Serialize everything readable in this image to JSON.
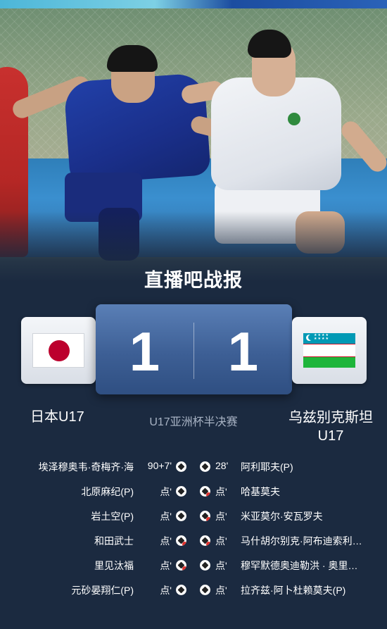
{
  "brand_title": "直播吧战报",
  "match": {
    "stage": "U17亚洲杯半决赛",
    "home": {
      "name": "日本U17",
      "score": "1",
      "flag": "japan-flag"
    },
    "away": {
      "name": "乌兹别克斯坦U17",
      "name_line1": "乌兹别克斯坦",
      "name_line2": "U17",
      "score": "1",
      "flag": "uzbekistan-flag"
    }
  },
  "events": [
    {
      "home_player": "埃泽穆奥韦·奇梅齐·海",
      "home_time": "90+7'",
      "home_result": "goal",
      "away_result": "goal",
      "away_time": "28'",
      "away_player": "阿利耶夫(P)"
    },
    {
      "home_player": "北原麻纪(P)",
      "home_time": "点'",
      "home_result": "goal",
      "away_result": "miss",
      "away_time": "点'",
      "away_player": "哈基莫夫"
    },
    {
      "home_player": "岩土空(P)",
      "home_time": "点'",
      "home_result": "goal",
      "away_result": "miss",
      "away_time": "点'",
      "away_player": "米亚莫尔·安瓦罗夫"
    },
    {
      "home_player": "和田武士",
      "home_time": "点'",
      "home_result": "miss",
      "away_result": "miss",
      "away_time": "点'",
      "away_player": "马什胡尔别克·阿布迪索利…"
    },
    {
      "home_player": "里见汰福",
      "home_time": "点'",
      "home_result": "miss",
      "away_result": "goal",
      "away_time": "点'",
      "away_player": "穆罕默德奥迪勒洪 · 奥里…"
    },
    {
      "home_player": "元砂晏翔仁(P)",
      "home_time": "点'",
      "home_result": "goal",
      "away_result": "goal",
      "away_time": "点'",
      "away_player": "拉齐兹·阿卜杜赖莫夫(P)"
    }
  ],
  "colors": {
    "background": "#1b2a40",
    "score_panel": "#3d5f95",
    "stage_text": "#a8b3c4",
    "miss_marker": "#e0322e"
  }
}
